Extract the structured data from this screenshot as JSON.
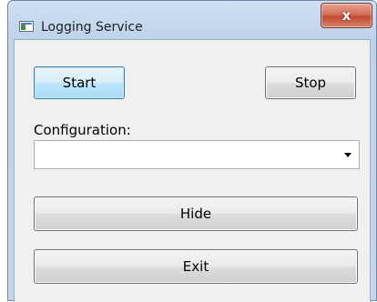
{
  "window": {
    "title": "Logging Service",
    "icon": "app-window-icon",
    "close_glyph": "x"
  },
  "buttons": {
    "start": "Start",
    "stop": "Stop",
    "hide": "Hide",
    "exit": "Exit"
  },
  "configuration": {
    "label": "Configuration:",
    "value": ""
  },
  "colors": {
    "close_button": "#c34a30",
    "default_button_accent": "#3c7fb1"
  }
}
